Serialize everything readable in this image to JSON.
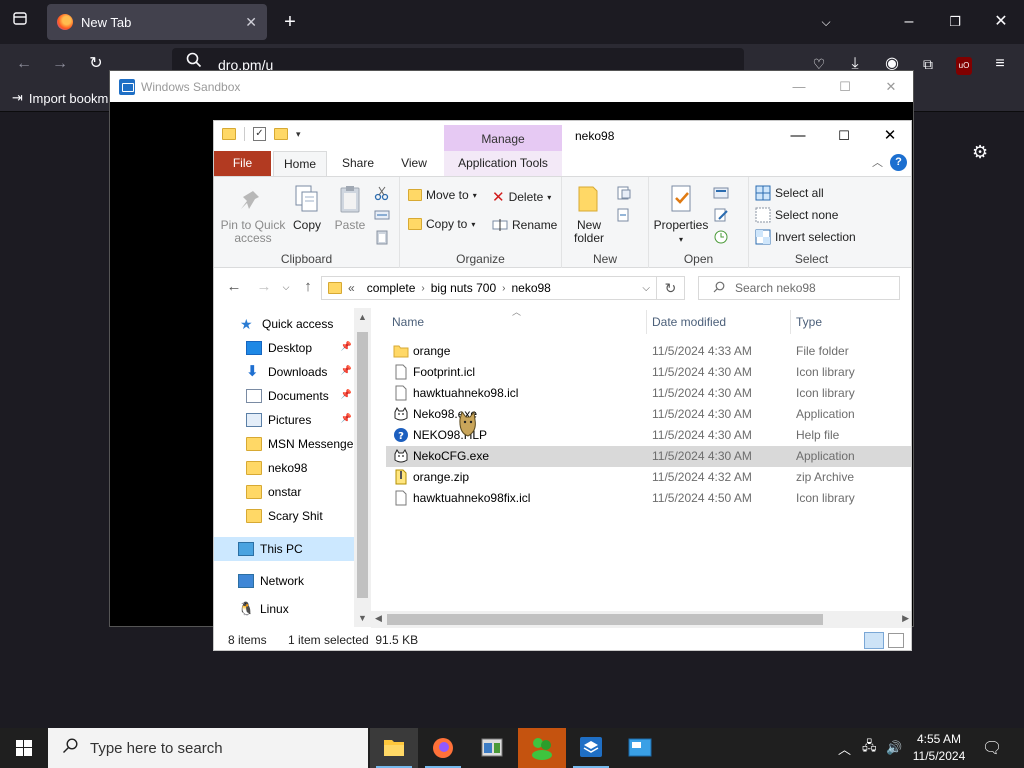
{
  "browser": {
    "tab_title": "New Tab",
    "url": "dro.pm/u",
    "bookmark_import": "Import bookm"
  },
  "sandbox": {
    "title": "Windows Sandbox"
  },
  "explorer": {
    "title": "neko98",
    "context_tab": "Manage",
    "tabs": [
      "File",
      "Home",
      "Share",
      "View",
      "Application Tools"
    ],
    "ribbon": {
      "clipboard": {
        "label": "Clipboard",
        "pin": "Pin to Quick access",
        "copy": "Copy",
        "paste": "Paste"
      },
      "organize": {
        "label": "Organize",
        "move_to": "Move to",
        "copy_to": "Copy to",
        "delete": "Delete",
        "rename": "Rename"
      },
      "new": {
        "label": "New",
        "new_folder": "New folder"
      },
      "open": {
        "label": "Open",
        "properties": "Properties"
      },
      "select": {
        "label": "Select",
        "select_all": "Select all",
        "select_none": "Select none",
        "invert": "Invert selection"
      }
    },
    "address": {
      "prefix": "«",
      "segments": [
        "complete",
        "big nuts 700",
        "neko98"
      ]
    },
    "search_placeholder": "Search neko98",
    "nav": {
      "quick_access": "Quick access",
      "items": [
        {
          "label": "Desktop",
          "pinned": true
        },
        {
          "label": "Downloads",
          "pinned": true
        },
        {
          "label": "Documents",
          "pinned": true
        },
        {
          "label": "Pictures",
          "pinned": true
        },
        {
          "label": "MSN Messenger",
          "pinned": false
        },
        {
          "label": "neko98",
          "pinned": false
        },
        {
          "label": "onstar",
          "pinned": false
        },
        {
          "label": "Scary Shit",
          "pinned": false
        }
      ],
      "this_pc": "This PC",
      "network": "Network",
      "linux": "Linux"
    },
    "columns": {
      "name": "Name",
      "date": "Date modified",
      "type": "Type"
    },
    "files": [
      {
        "name": "orange",
        "date": "11/5/2024 4:33 AM",
        "type": "File folder",
        "icon": "folder-icon"
      },
      {
        "name": "Footprint.icl",
        "date": "11/5/2024 4:30 AM",
        "type": "Icon library",
        "icon": "file-icon"
      },
      {
        "name": "hawktuahneko98.icl",
        "date": "11/5/2024 4:30 AM",
        "type": "Icon library",
        "icon": "file-icon"
      },
      {
        "name": "Neko98.exe",
        "date": "11/5/2024 4:30 AM",
        "type": "Application",
        "icon": "cat-icon"
      },
      {
        "name": "NEKO98.HLP",
        "date": "11/5/2024 4:30 AM",
        "type": "Help file",
        "icon": "help-icon"
      },
      {
        "name": "NekoCFG.exe",
        "date": "11/5/2024 4:30 AM",
        "type": "Application",
        "icon": "cat-icon",
        "selected": true
      },
      {
        "name": "orange.zip",
        "date": "11/5/2024 4:32 AM",
        "type": "zip Archive",
        "icon": "zip-icon"
      },
      {
        "name": "hawktuahneko98fix.icl",
        "date": "11/5/2024 4:50 AM",
        "type": "Icon library",
        "icon": "file-icon"
      }
    ],
    "status": {
      "count": "8 items",
      "selection": "1 item selected  91.5 KB"
    }
  },
  "taskbar": {
    "search_placeholder": "Type here to search",
    "time": "4:55 AM",
    "date": "11/5/2024"
  },
  "colors": {
    "file_tab": "#b23a21",
    "manage_tab": "#e6c9f3",
    "selection": "#cce8ff",
    "firefox_bg": "#1c1b22",
    "taskbar": "#1f1f1f"
  }
}
